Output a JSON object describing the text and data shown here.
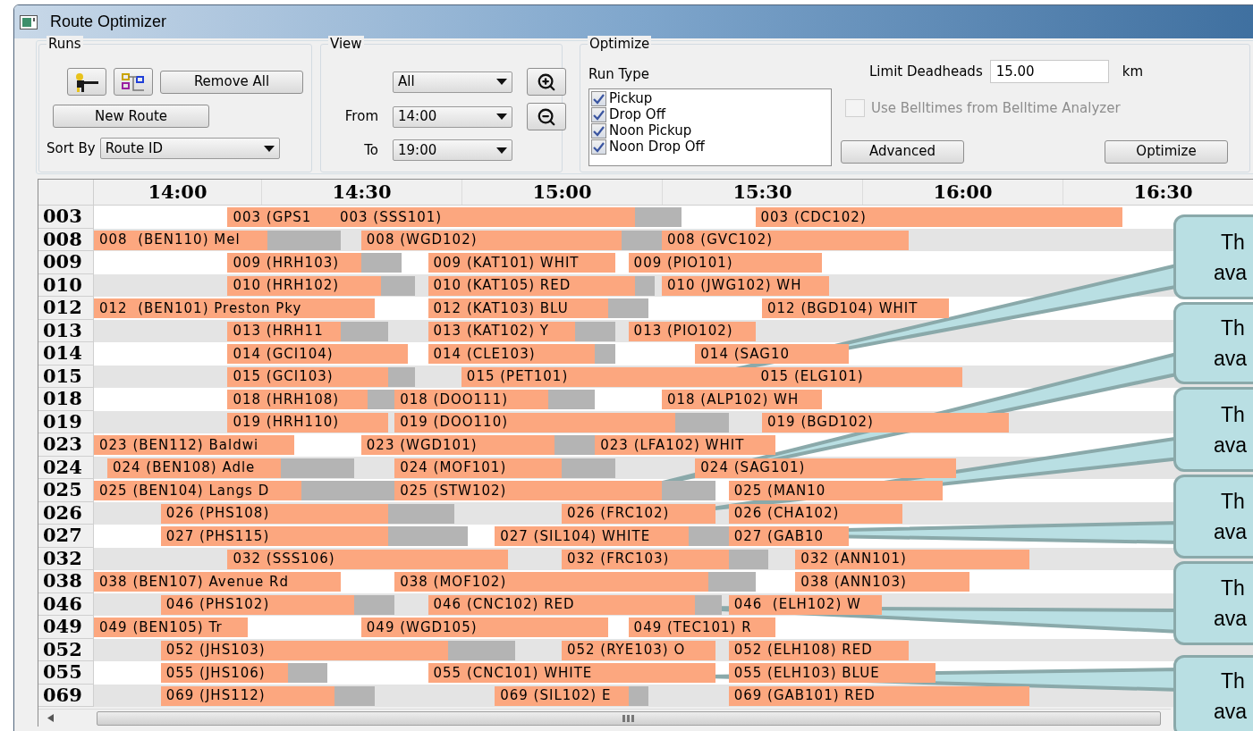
{
  "window": {
    "title": "Route Optimizer"
  },
  "runs": {
    "title": "Runs",
    "remove_all": "Remove All",
    "new_route": "New Route",
    "sort_label": "Sort By",
    "sort_value": "Route ID"
  },
  "view": {
    "title": "View",
    "filter": "All",
    "from_label": "From",
    "from": "14:00",
    "to_label": "To",
    "to": "19:00"
  },
  "optimize": {
    "title": "Optimize",
    "run_type_label": "Run Type",
    "run_types": [
      {
        "label": "Pickup",
        "checked": true
      },
      {
        "label": "Drop Off",
        "checked": true
      },
      {
        "label": "Noon Pickup",
        "checked": true
      },
      {
        "label": "Noon Drop Off",
        "checked": true
      }
    ],
    "deadheads_label": "Limit Deadheads",
    "deadheads_value": "15.00",
    "unit": "km",
    "belltimes": {
      "label": "Use Belltimes from Belltime Analyzer",
      "checked": false,
      "disabled": true
    },
    "advanced": "Advanced",
    "optimize": "Optimize"
  },
  "schedule": {
    "times": [
      "14:00",
      "14:30",
      "15:00",
      "15:30",
      "16:00",
      "16:30"
    ],
    "rows": [
      {
        "route": "003",
        "runs": [
          "003 (GPS1",
          "003 (SSS101)",
          "003 (CDC102)"
        ]
      },
      {
        "route": "008",
        "runs": [
          "008  (BEN110) Mel",
          "008 (WGD102)",
          "008 (GVC102)"
        ]
      },
      {
        "route": "009",
        "runs": [
          "009 (HRH103)",
          "009 (KAT101) WHIT",
          "009 (PIO101)"
        ]
      },
      {
        "route": "010",
        "runs": [
          "010 (HRH102)",
          "010 (KAT105) RED",
          "010 (JWG102) WH"
        ]
      },
      {
        "route": "012",
        "runs": [
          "012  (BEN101) Preston Pky",
          "012 (KAT103) BLU",
          "012 (BGD104) WHIT"
        ]
      },
      {
        "route": "013",
        "runs": [
          "013 (HRH11",
          "013 (KAT102) Y",
          "013 (PIO102)"
        ]
      },
      {
        "route": "014",
        "runs": [
          "014 (GCI104)",
          "014 (CLE103)",
          "014 (SAG10"
        ]
      },
      {
        "route": "015",
        "runs": [
          "015 (GCI103)",
          "015 (PET101)",
          "015 (ELG101)"
        ]
      },
      {
        "route": "018",
        "runs": [
          "018 (HRH108)",
          "018 (DOO111)",
          "018 (ALP102) WH"
        ]
      },
      {
        "route": "019",
        "runs": [
          "019 (HRH110)",
          "019 (DOO110)",
          "019 (BGD102)"
        ]
      },
      {
        "route": "023",
        "runs": [
          "023 (BEN112) Baldwi",
          "023 (WGD101)",
          "023 (LFA102) WHIT"
        ]
      },
      {
        "route": "024",
        "runs": [
          "024 (BEN108) Adle",
          "024 (MOF101)",
          "024 (SAG101)"
        ]
      },
      {
        "route": "025",
        "runs": [
          "025 (BEN104) Langs D",
          "025 (STW102)",
          "025 (MAN10"
        ]
      },
      {
        "route": "026",
        "runs": [
          "026 (PHS108)",
          "026 (FRC102)",
          "026 (CHA102)"
        ]
      },
      {
        "route": "027",
        "runs": [
          "027 (PHS115)",
          "027 (SIL104) WHITE",
          "027 (GAB10"
        ]
      },
      {
        "route": "032",
        "runs": [
          "032 (SSS106)",
          "032 (FRC103)",
          "032 (ANN101)"
        ]
      },
      {
        "route": "038",
        "runs": [
          "038 (BEN107) Avenue Rd",
          "038 (MOF102)",
          "038 (ANN103)"
        ]
      },
      {
        "route": "046",
        "runs": [
          "046 (PHS102)",
          "046 (CNC102) RED",
          "046  (ELH102) W"
        ]
      },
      {
        "route": "049",
        "runs": [
          "049 (BEN105) Tr",
          "049 (WGD105)",
          "049 (TEC101) R"
        ]
      },
      {
        "route": "052",
        "runs": [
          "052 (JHS103)",
          "052 (RYE103) O",
          "052 (ELH108) RED"
        ]
      },
      {
        "route": "055",
        "runs": [
          "055 (JHS106)",
          "055 (CNC101) WHITE",
          "055 (ELH103) BLUE"
        ]
      },
      {
        "route": "069",
        "runs": [
          "069 (JHS112)",
          "069 (SIL102) E",
          "069 (GAB101) RED"
        ]
      }
    ]
  },
  "callouts": [
    {
      "lines": [
        "Th",
        "ava"
      ]
    },
    {
      "lines": [
        "Th",
        "ava"
      ]
    },
    {
      "lines": [
        "Th",
        "ava"
      ]
    },
    {
      "lines": [
        "Th",
        "ava"
      ]
    },
    {
      "lines": [
        "Th",
        "ava"
      ]
    },
    {
      "lines": [
        "Th",
        "ava"
      ]
    }
  ]
}
